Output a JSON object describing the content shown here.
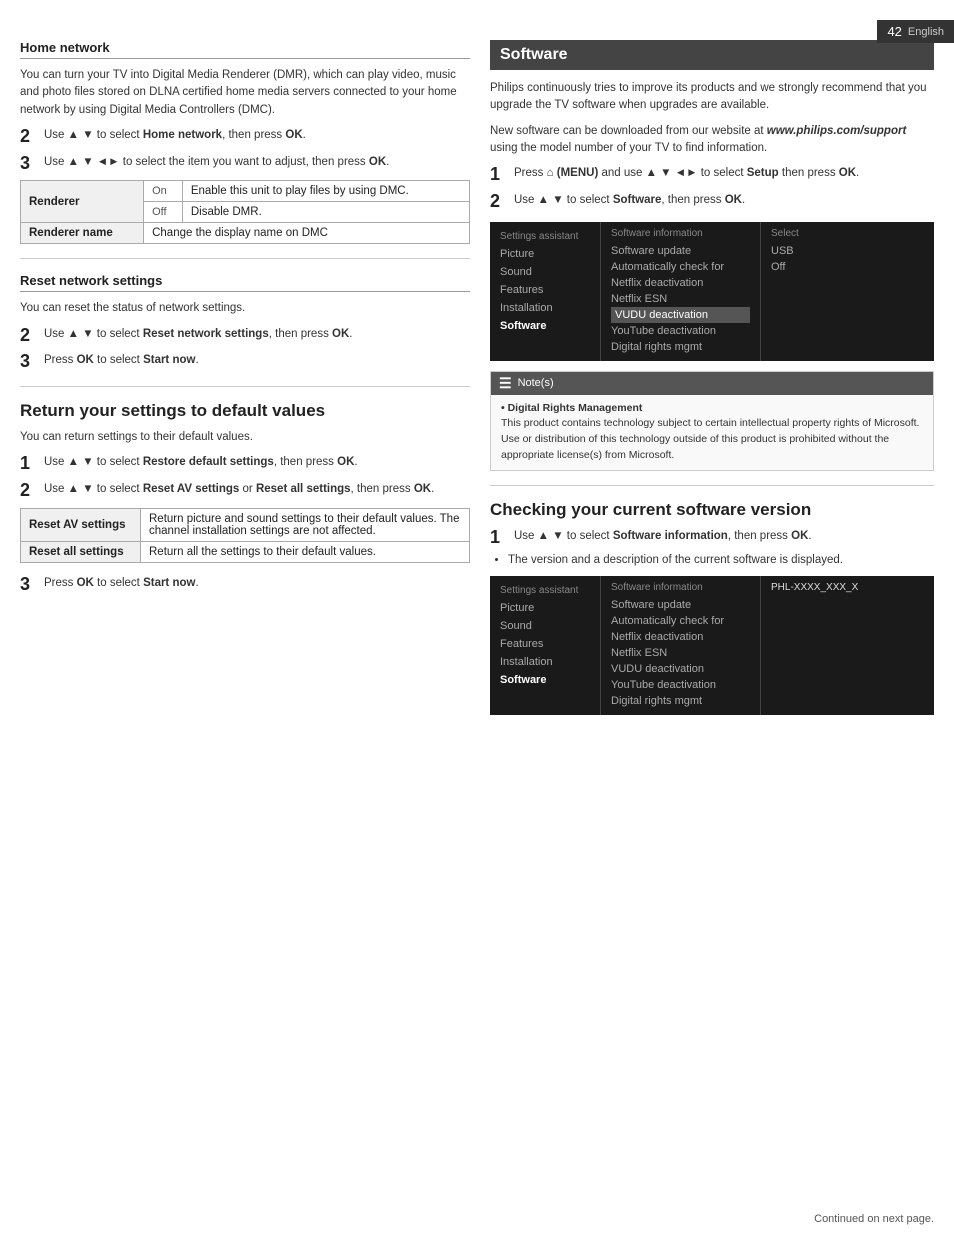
{
  "page": {
    "number": "42",
    "language": "English",
    "footer": "Continued on next page."
  },
  "left_column": {
    "sections": [
      {
        "id": "home-network",
        "title": "Home network",
        "body1": "You can turn your TV into Digital Media Renderer (DMR), which can play video, music and photo files stored on DLNA certified home media servers connected to your home network by using Digital Media Controllers (DMC).",
        "step2": "Use ▲ ▼ to select Home network, then press OK.",
        "step3": "Use ▲ ▼ ◄► to select the item you want to adjust, then press OK.",
        "table": {
          "rows": [
            {
              "label": "Renderer",
              "subLabel": "On",
              "value": "Enable this unit to play files by using DMC."
            },
            {
              "label": "",
              "subLabel": "Off",
              "value": "Disable DMR."
            },
            {
              "label": "Renderer name",
              "subLabel": "",
              "value": "Change the display name on DMC"
            }
          ]
        }
      },
      {
        "id": "reset-network",
        "title": "Reset network settings",
        "body1": "You can reset the status of network settings.",
        "step2": "Use ▲ ▼ to select Reset network settings, then press OK.",
        "step3": "Press OK to select Start now."
      }
    ],
    "return_settings": {
      "heading": "Return your settings to default values",
      "body": "You can return settings to their default values.",
      "step1": "Use ▲ ▼ to select Restore default settings, then press OK.",
      "step2": "Use ▲ ▼ to select Reset AV settings or Reset all settings, then press OK.",
      "table": {
        "rows": [
          {
            "label": "Reset AV settings",
            "value": "Return picture and sound settings to their default values. The channel installation settings are not affected."
          },
          {
            "label": "Reset all settings",
            "value": "Return all the settings to their default values."
          }
        ]
      },
      "step3": "Press OK to select Start now."
    }
  },
  "right_column": {
    "software_section": {
      "title": "Software",
      "body1": "Philips continuously tries to improve its products and we strongly recommend that you upgrade the TV software when upgrades are available.",
      "body2": "New software can be downloaded from our website at www.philips.com/support using the model number of your TV to find information.",
      "step1": "Press  (MENU) and use ▲ ▼ ◄► to select Setup then press OK.",
      "step2": "Use ▲ ▼ to select Software, then press OK.",
      "settings_panel": {
        "left_col_header": "Settings assistant",
        "left_items": [
          "Picture",
          "Sound",
          "Features",
          "Installation",
          "Software"
        ],
        "mid_col_header": "Software information",
        "mid_items": [
          "Software update",
          "Automatically check for",
          "Netflix deactivation",
          "Netflix ESN",
          "VUDU deactivation",
          "YouTube deactivation",
          "Digital rights mgmt"
        ],
        "right_col_header": "Select",
        "right_items": [
          "USB",
          "Off"
        ]
      },
      "note": {
        "header": "Note(s)",
        "bullet": "Digital Rights Management",
        "body": "This product contains technology subject to certain intellectual property rights of Microsoft. Use or distribution of this technology outside of this product is prohibited without the appropriate license(s) from Microsoft."
      }
    },
    "checking_section": {
      "heading": "Checking your current software version",
      "step1": "Use ▲ ▼ to select Software information, then press OK.",
      "bullet": "The version and a description of the current software is displayed.",
      "settings_panel": {
        "left_col_header": "Settings assistant",
        "left_items": [
          "Picture",
          "Sound",
          "Features",
          "Installation",
          "Software"
        ],
        "mid_col_header": "Software information",
        "mid_items": [
          "Software update",
          "Automatically check for",
          "Netflix deactivation",
          "Netflix ESN",
          "VUDU deactivation",
          "YouTube deactivation",
          "Digital rights mgmt"
        ],
        "right_col_header": "PHL-XXXX_XXX_X",
        "right_items": []
      }
    }
  }
}
